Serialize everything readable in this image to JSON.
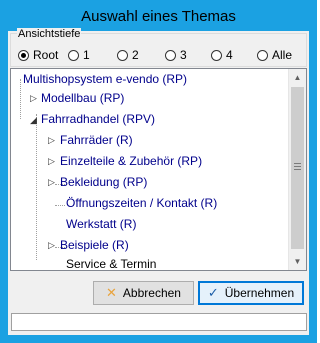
{
  "window": {
    "title": "Auswahl eines Themas"
  },
  "depth": {
    "legend": "Ansichtstiefe",
    "options": [
      "Root",
      "1",
      "2",
      "3",
      "4",
      "Alle"
    ],
    "selected": "Root"
  },
  "tree": {
    "root": "Multishopsystem e-vendo (RP)",
    "modellbau": "Modellbau (RP)",
    "fahrradhandel": "Fahrradhandel (RPV)",
    "children": [
      {
        "label": "Fahrräder (R)",
        "expandable": true
      },
      {
        "label": "Einzelteile & Zubehör (RP)",
        "expandable": true
      },
      {
        "label": "Bekleidung (RP)",
        "expandable": true
      },
      {
        "label": "Öffnungszeiten / Kontakt (R)",
        "expandable": false
      },
      {
        "label": "Werkstatt (R)",
        "expandable": false
      },
      {
        "label": "Beispiele (R)",
        "expandable": true
      },
      {
        "label": "Service & Termin",
        "expandable": false
      }
    ]
  },
  "buttons": {
    "cancel": "Abbrechen",
    "accept": "Übernehmen"
  },
  "status": {
    "text": ""
  }
}
